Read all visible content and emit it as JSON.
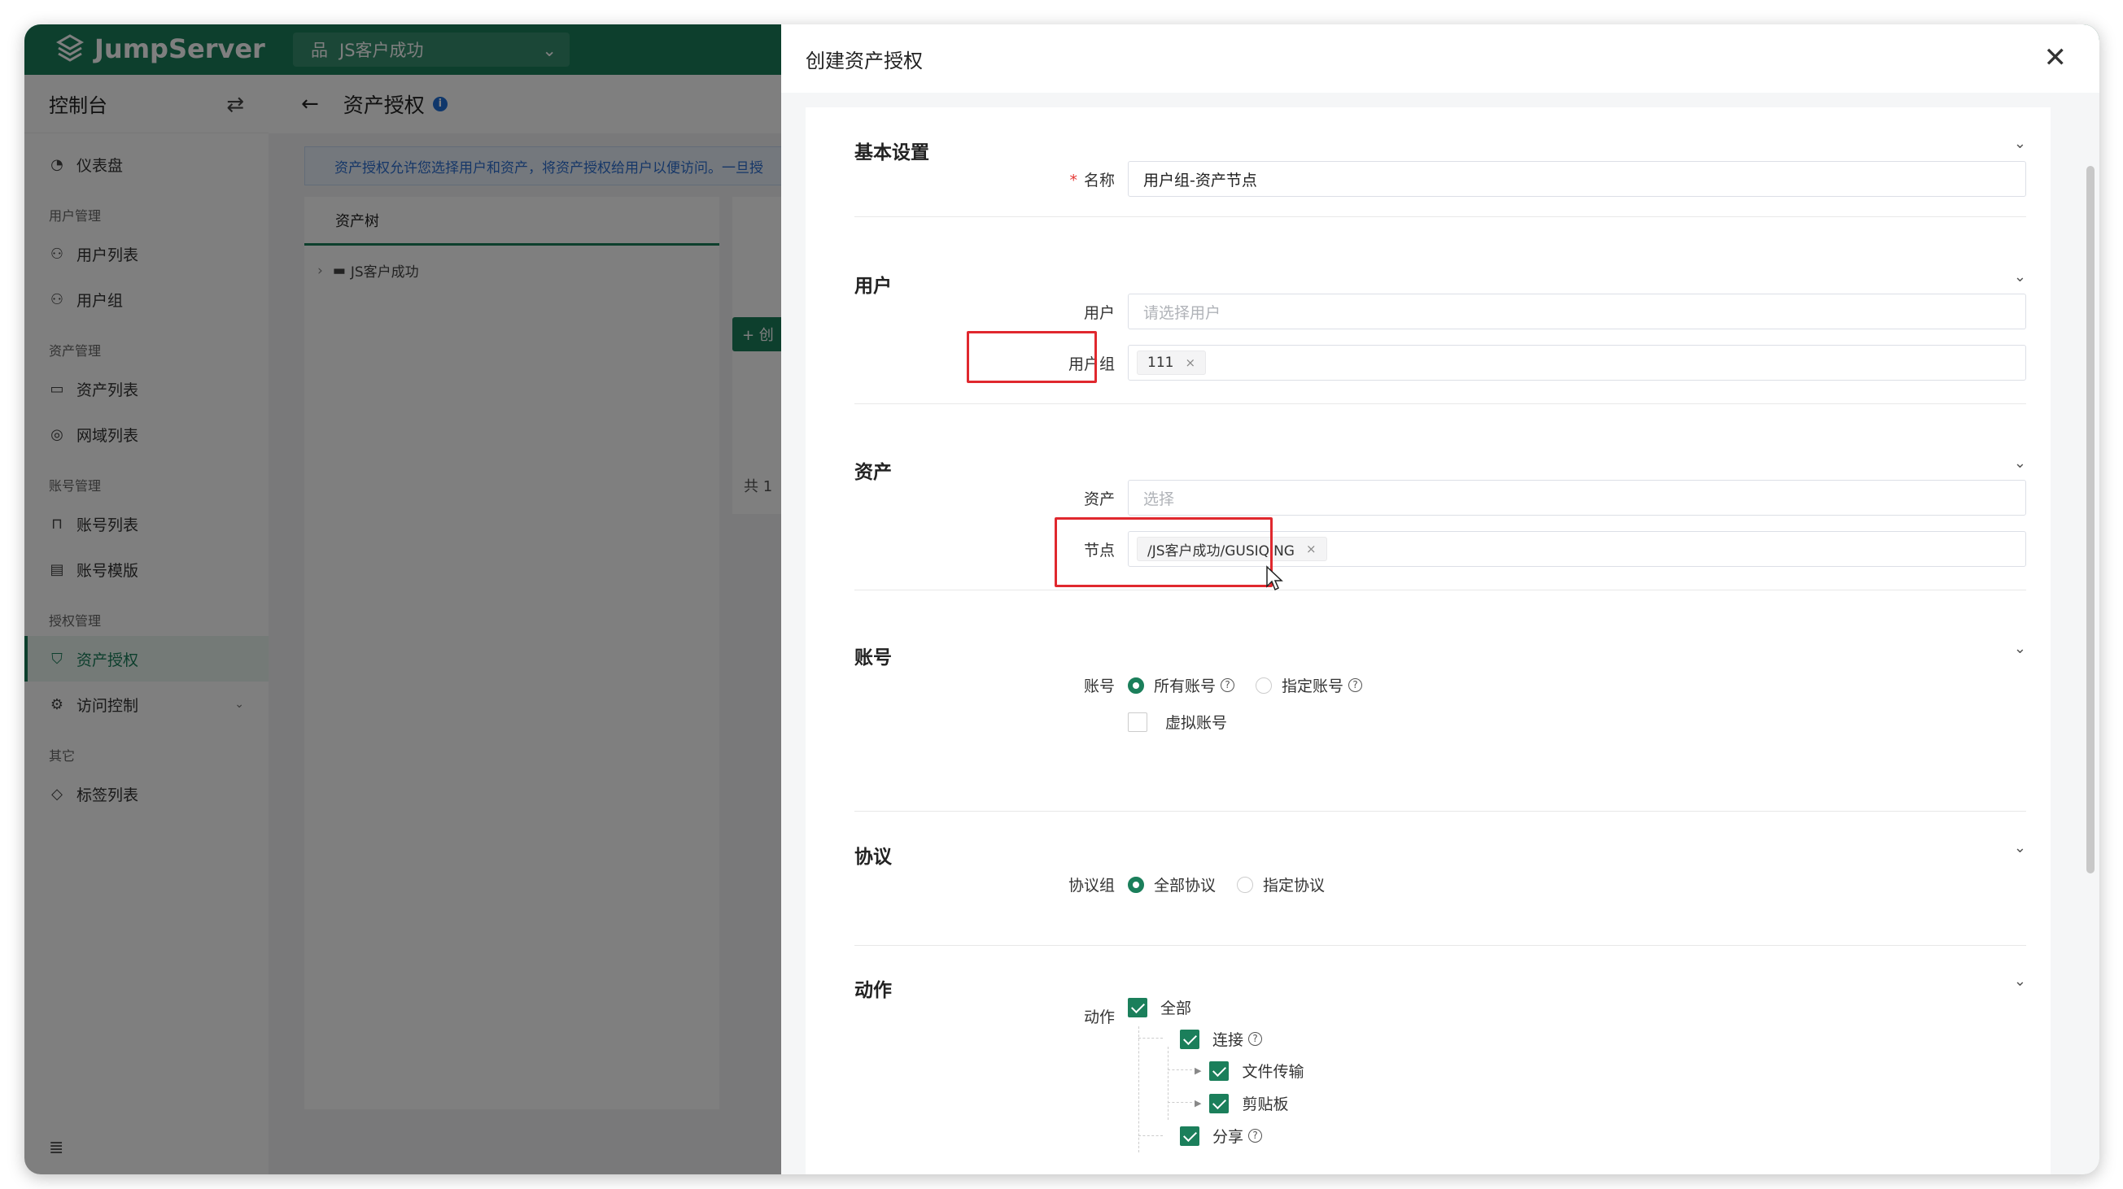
{
  "app": {
    "brand": "JumpServer",
    "org_select": "JS客户成功"
  },
  "sidebar": {
    "title": "控制台",
    "dashboard": "仪表盘",
    "groups": {
      "user_mgmt": "用户管理",
      "asset_mgmt": "资产管理",
      "account_mgmt": "账号管理",
      "perm_mgmt": "授权管理",
      "other": "其它"
    },
    "items": {
      "user_list": "用户列表",
      "user_group": "用户组",
      "asset_list": "资产列表",
      "domain_list": "网域列表",
      "account_list": "账号列表",
      "account_template": "账号模版",
      "asset_perm": "资产授权",
      "access_control": "访问控制",
      "label_list": "标签列表"
    }
  },
  "page": {
    "title": "资产授权",
    "notice": "资产授权允许您选择用户和资产，将资产授权给用户以便访问。一旦授",
    "tree_tab": "资产树",
    "tree_node": "JS客户成功",
    "create_btn": "+ 创",
    "total": "共 1"
  },
  "drawer": {
    "title": "创建资产授权",
    "basic": {
      "title": "基本设置",
      "name_label": "名称",
      "name_value": "用户组-资产节点"
    },
    "users": {
      "title": "用户",
      "user_label": "用户",
      "user_placeholder": "请选择用户",
      "group_label": "用户组",
      "group_tag": "111"
    },
    "assets": {
      "title": "资产",
      "asset_label": "资产",
      "asset_placeholder": "选择",
      "node_label": "节点",
      "node_tag": "/JS客户成功/GUSIQING"
    },
    "accounts": {
      "title": "账号",
      "label": "账号",
      "opt_all": "所有账号",
      "opt_specified": "指定账号",
      "virtual": "虚拟账号"
    },
    "protocols": {
      "title": "协议",
      "label": "协议组",
      "opt_all": "全部协议",
      "opt_specified": "指定协议"
    },
    "actions": {
      "title": "动作",
      "label": "动作",
      "all": "全部",
      "connect": "连接",
      "file_transfer": "文件传输",
      "clipboard": "剪贴板",
      "share": "分享"
    }
  }
}
